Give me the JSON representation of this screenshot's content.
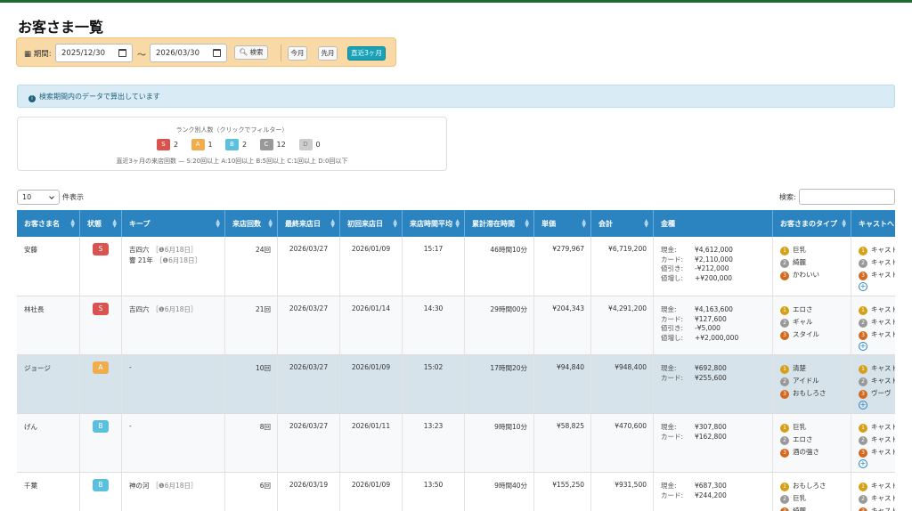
{
  "page": {
    "title": "お客さま一覧"
  },
  "search": {
    "period_label": "期間:",
    "date_from": "2025/12/30",
    "tilde": "〜",
    "date_to": "2026/03/30",
    "search_button": "検索",
    "quick": [
      "今月",
      "先月",
      "直近3ヶ月"
    ],
    "quick_active": 2
  },
  "info": {
    "text": "検索期間内のデータで算出しています"
  },
  "rank_summary": {
    "title": "ランク別人数（クリックでフィルター）",
    "ranks": [
      {
        "code": "S",
        "count": "2",
        "color": "#d9534f"
      },
      {
        "code": "A",
        "count": "1",
        "color": "#f0ad4e"
      },
      {
        "code": "B",
        "count": "2",
        "color": "#5bc0de"
      },
      {
        "code": "C",
        "count": "12",
        "color": "#999999"
      },
      {
        "code": "D",
        "count": "0",
        "color": "#cccccc"
      }
    ],
    "note": "直近3ヶ月の来店回数 — S:20回以上 A:10回以上 B:5回以上 C:1回以上 D:0回以下"
  },
  "table_controls": {
    "length_value": "10",
    "length_label": "件表示",
    "search_label": "検索:"
  },
  "columns": [
    "お客さま名",
    "状態",
    "キープ",
    "来店回数",
    "最終来店日",
    "初回来店日",
    "来店時間平均",
    "累計滞在時間",
    "単価",
    "会計",
    "金種",
    "お客さまのタイプ",
    "キャストへ"
  ],
  "money_labels": [
    "現金:",
    "カード:",
    "値引き:",
    "値増し:"
  ],
  "rows": [
    {
      "name": "安藤",
      "rank": "S",
      "rank_color": "#d9534f",
      "keep": [
        {
          "item": "吉四六",
          "tag": "［❶6月18日］"
        },
        {
          "item": "響 21年",
          "tag": "［❶6月18日］"
        }
      ],
      "visits": "24回",
      "last": "2026/03/27",
      "first": "2026/01/09",
      "avg_time": "15:17",
      "total_stay": "46時間10分",
      "unit": "¥279,967",
      "total": "¥6,719,200",
      "money": [
        "¥4,612,000",
        "¥2,110,000",
        "-¥212,000",
        "+¥200,000"
      ],
      "types": [
        "巨乳",
        "綺麗",
        "かわいい"
      ],
      "casts": [
        "キャスト",
        "キャスト",
        "キャスト"
      ]
    },
    {
      "name": "林社長",
      "rank": "S",
      "rank_color": "#d9534f",
      "keep": [
        {
          "item": "吉四六",
          "tag": "［❶6月18日］"
        }
      ],
      "visits": "21回",
      "last": "2026/03/27",
      "first": "2026/01/14",
      "avg_time": "14:30",
      "total_stay": "29時間00分",
      "unit": "¥204,343",
      "total": "¥4,291,200",
      "money": [
        "¥4,163,600",
        "¥127,600",
        "-¥5,000",
        "+¥2,000,000"
      ],
      "types": [
        "エロさ",
        "ギャル",
        "スタイル"
      ],
      "casts": [
        "キャスト",
        "キャスト",
        "キャスト"
      ]
    },
    {
      "name": "ジョージ",
      "rank": "A",
      "rank_color": "#f0ad4e",
      "keep": [
        {
          "item": "-",
          "tag": ""
        }
      ],
      "visits": "10回",
      "last": "2026/03/27",
      "first": "2026/01/09",
      "avg_time": "15:02",
      "total_stay": "17時間20分",
      "unit": "¥94,840",
      "total": "¥948,400",
      "money": [
        "¥692,800",
        "¥255,600"
      ],
      "types": [
        "清楚",
        "アイドル",
        "おもしろさ"
      ],
      "casts": [
        "キャスト",
        "キャスト",
        "ヴーヴ"
      ]
    },
    {
      "name": "げん",
      "rank": "B",
      "rank_color": "#5bc0de",
      "keep": [
        {
          "item": "-",
          "tag": ""
        }
      ],
      "visits": "8回",
      "last": "2026/03/27",
      "first": "2026/01/11",
      "avg_time": "13:23",
      "total_stay": "9時間10分",
      "unit": "¥58,825",
      "total": "¥470,600",
      "money": [
        "¥307,800",
        "¥162,800"
      ],
      "types": [
        "巨乳",
        "エロさ",
        "酒の強さ"
      ],
      "casts": [
        "キャスト",
        "キャスト",
        "キャスト"
      ]
    },
    {
      "name": "千葉",
      "rank": "B",
      "rank_color": "#5bc0de",
      "keep": [
        {
          "item": "神の河",
          "tag": "［❶6月18日］"
        }
      ],
      "visits": "6回",
      "last": "2026/03/19",
      "first": "2026/01/09",
      "avg_time": "13:50",
      "total_stay": "9時間40分",
      "unit": "¥155,250",
      "total": "¥931,500",
      "money": [
        "¥687,300",
        "¥244,200"
      ],
      "types": [
        "おもしろさ",
        "巨乳",
        "綺麗"
      ],
      "casts": [
        "キャスト",
        "キャスト",
        "キャスト"
      ]
    }
  ]
}
